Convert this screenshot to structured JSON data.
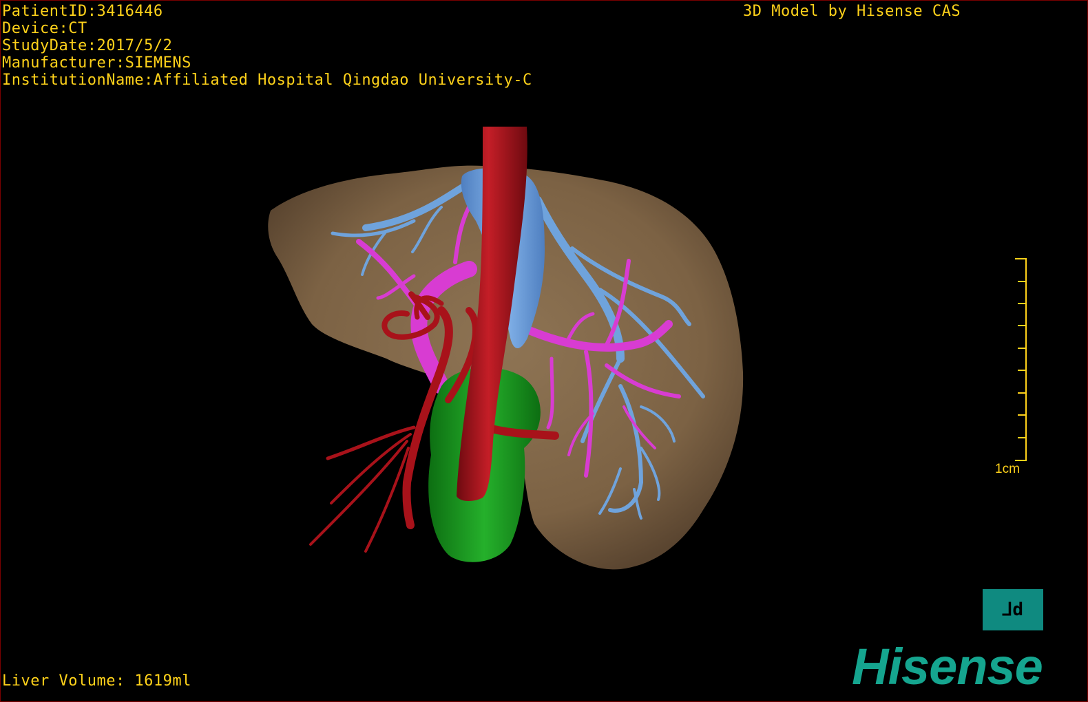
{
  "info": {
    "patient_id": "PatientID:3416446",
    "device": "Device:CT",
    "study_date": "StudyDate:2017/5/2",
    "manufacturer": "Manufacturer:SIEMENS",
    "institution": "InstitutionName:Affiliated Hospital Qingdao University-C"
  },
  "credit": "3D Model by Hisense CAS",
  "liver_volume": "Liver Volume: 1619ml",
  "scale": {
    "label": "1cm"
  },
  "view_cube": {
    "label": "⅃d"
  },
  "brand": "Hisense",
  "colors": {
    "liver": "#8a6d4e",
    "hepatic_vein": "#6fa3dc",
    "portal_vein": "#d83cd2",
    "artery": "#a8121a",
    "gallbladder": "#1d9e22",
    "overlay_text": "#ffd21a",
    "brand": "#15a58f"
  }
}
